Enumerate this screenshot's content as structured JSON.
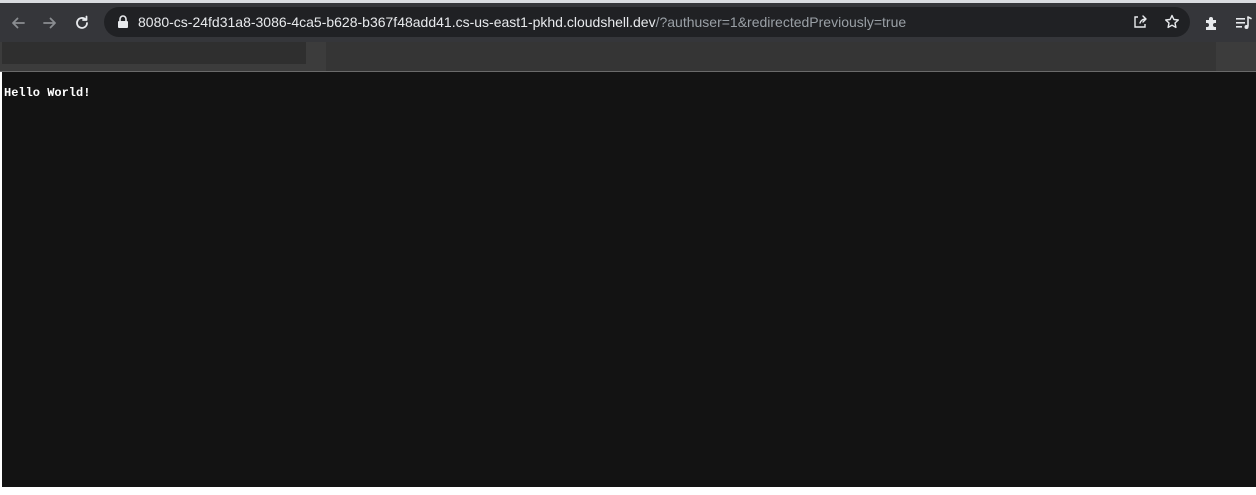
{
  "browser": {
    "url_host": "8080-cs-24fd31a8-3086-4ca5-b628-b367f48add41.cs-us-east1-pkhd.cloudshell.dev",
    "url_query": "/?authuser=1&redirectedPreviously=true",
    "icons": {
      "back": "arrow-left-icon",
      "forward": "arrow-right-icon",
      "reload": "reload-icon",
      "lock": "lock-icon",
      "share": "share-icon",
      "bookmark": "star-icon",
      "extensions": "puzzle-icon",
      "media": "media-queue-icon"
    },
    "colors": {
      "toolbar": "#35363a",
      "omnibox": "#202124",
      "page_background": "#131313",
      "page_text": "#ffffff"
    }
  },
  "page": {
    "body_text": "Hello World!"
  }
}
